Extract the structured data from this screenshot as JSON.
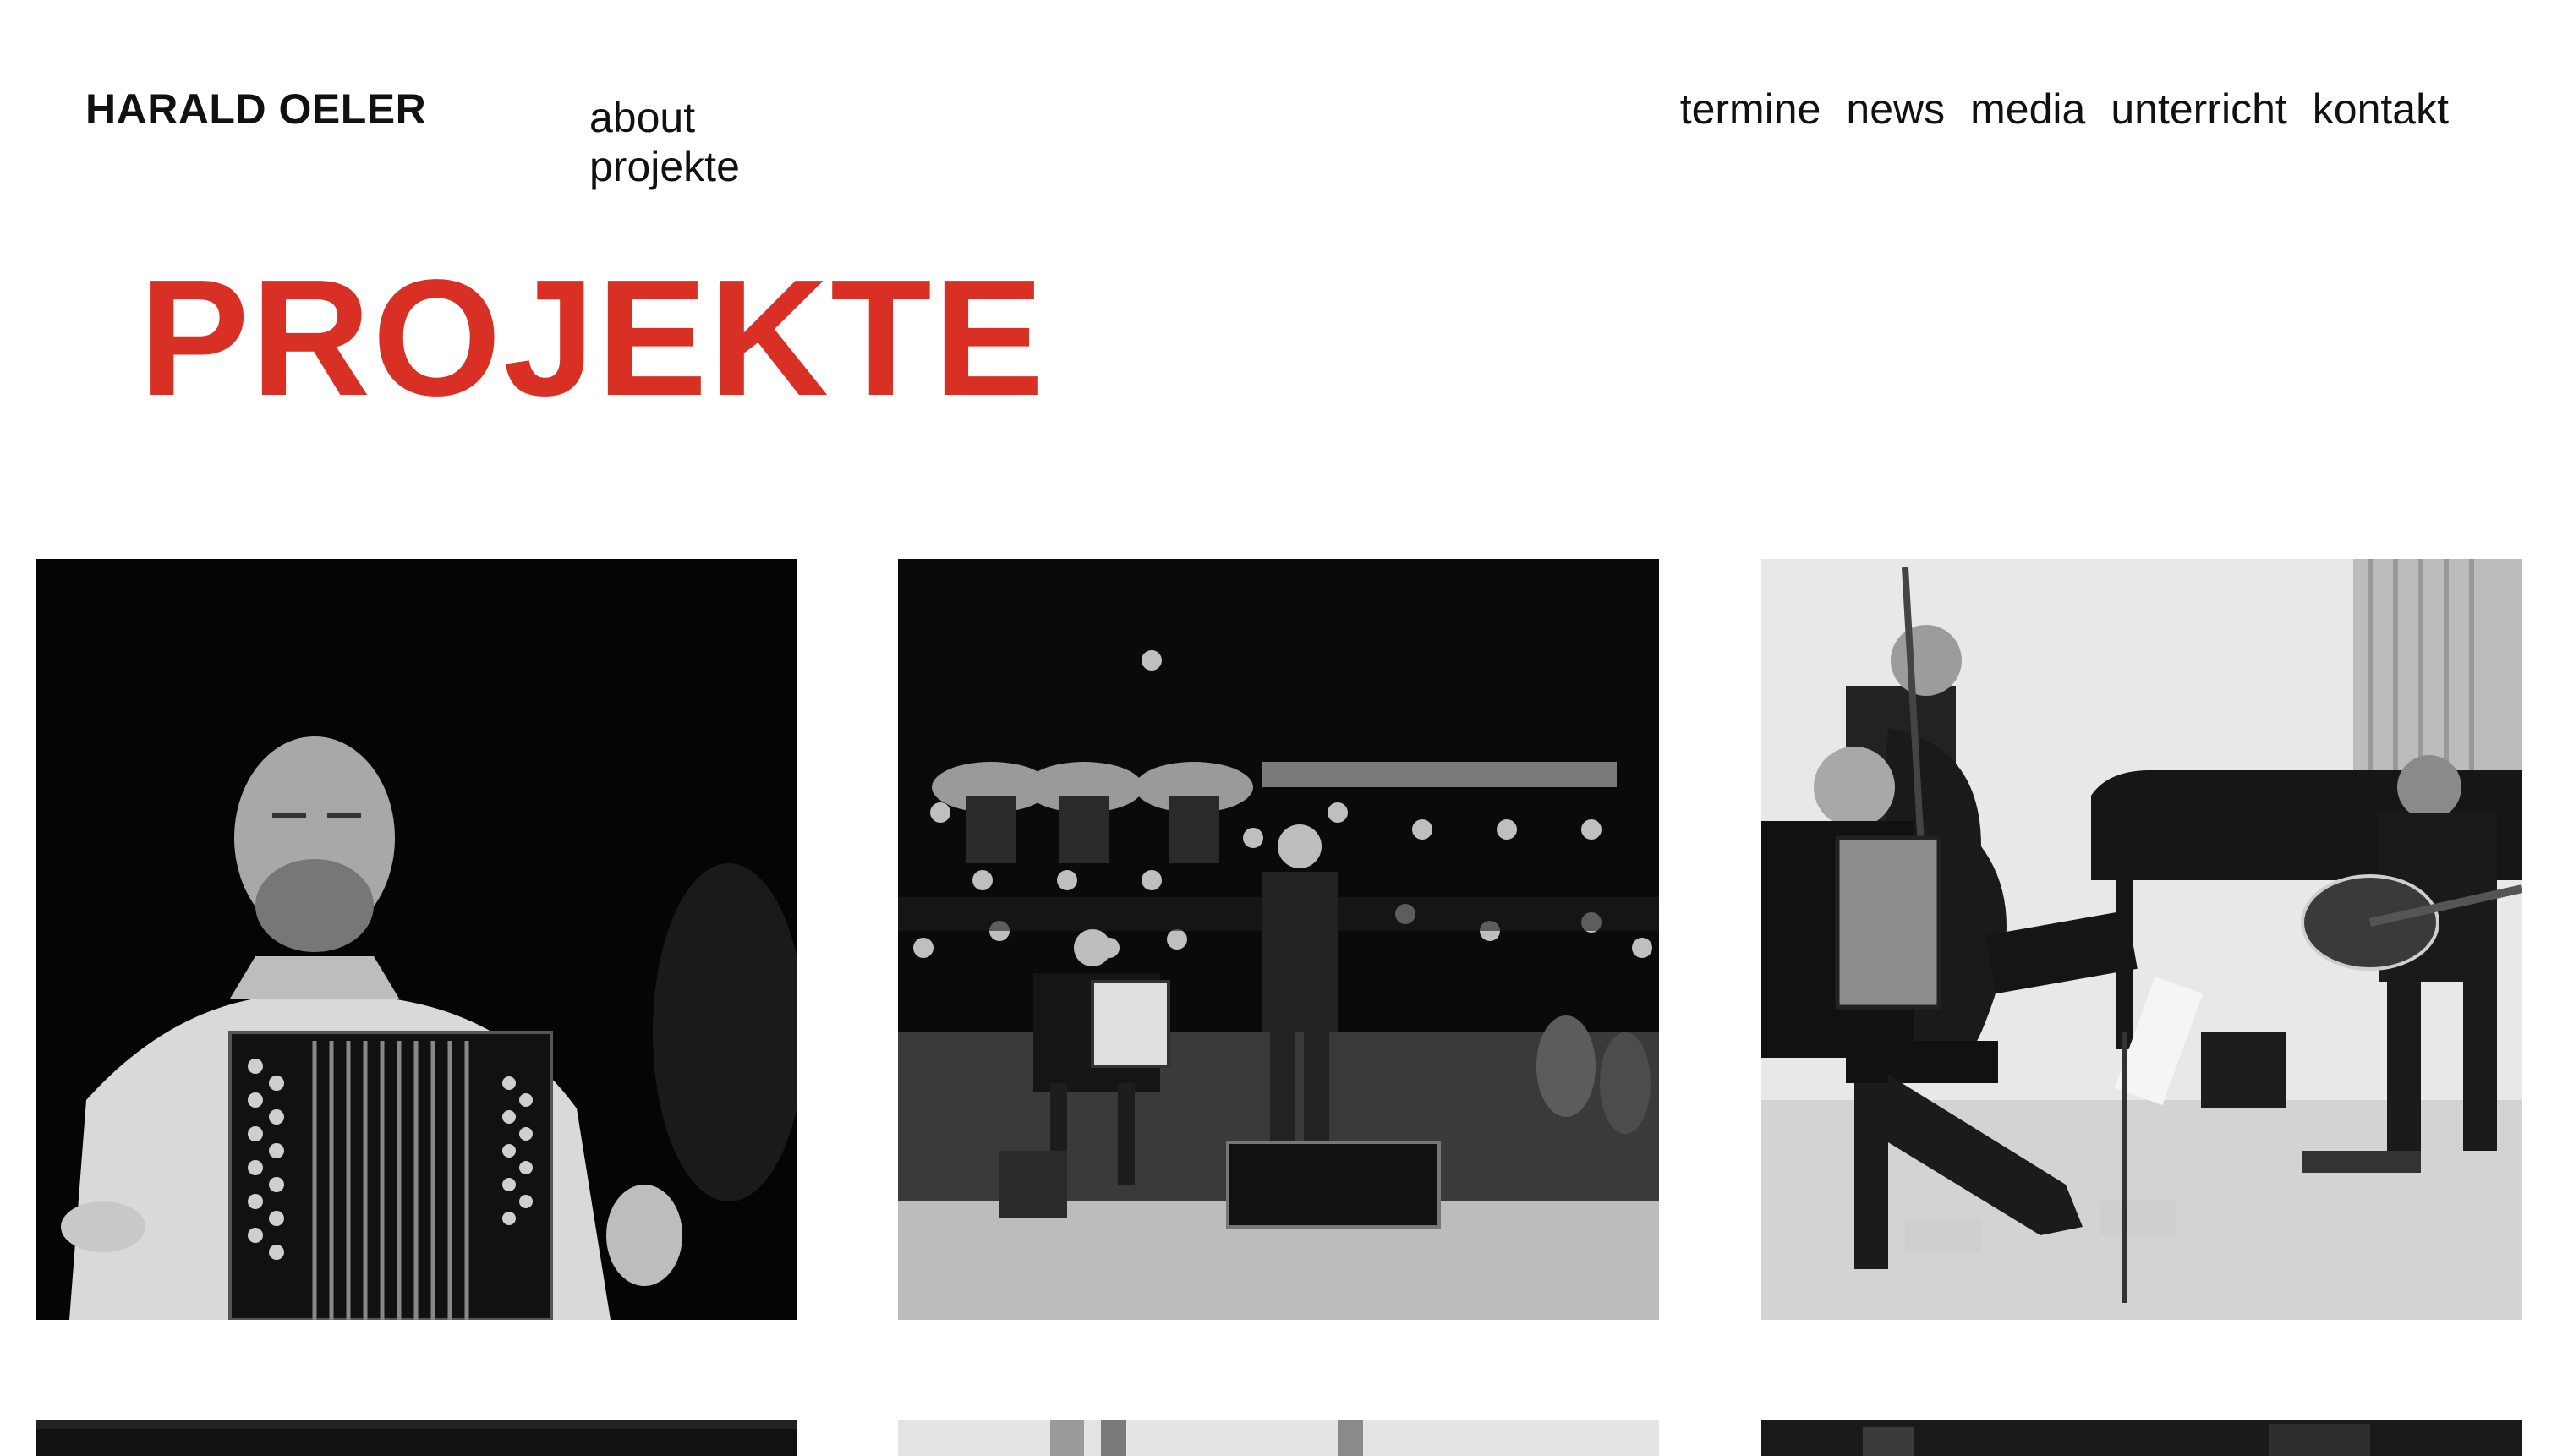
{
  "header": {
    "brand": "HARALD OELER",
    "subnav": [
      {
        "label": "about"
      },
      {
        "label": "projekte"
      }
    ],
    "mainnav": [
      {
        "label": "termine"
      },
      {
        "label": "news"
      },
      {
        "label": "media"
      },
      {
        "label": "unterricht"
      },
      {
        "label": "kontakt"
      }
    ]
  },
  "main": {
    "title": "PROJEKTE",
    "title_color": "#d93025"
  },
  "projects": [
    {
      "image": "accordion-player-portrait-photo"
    },
    {
      "image": "orchestra-with-accordion-soloist-photo"
    },
    {
      "image": "ensemble-accordion-bass-guitar-photo"
    },
    {
      "image": "project-photo-4"
    },
    {
      "image": "project-photo-5"
    },
    {
      "image": "project-photo-6"
    }
  ]
}
